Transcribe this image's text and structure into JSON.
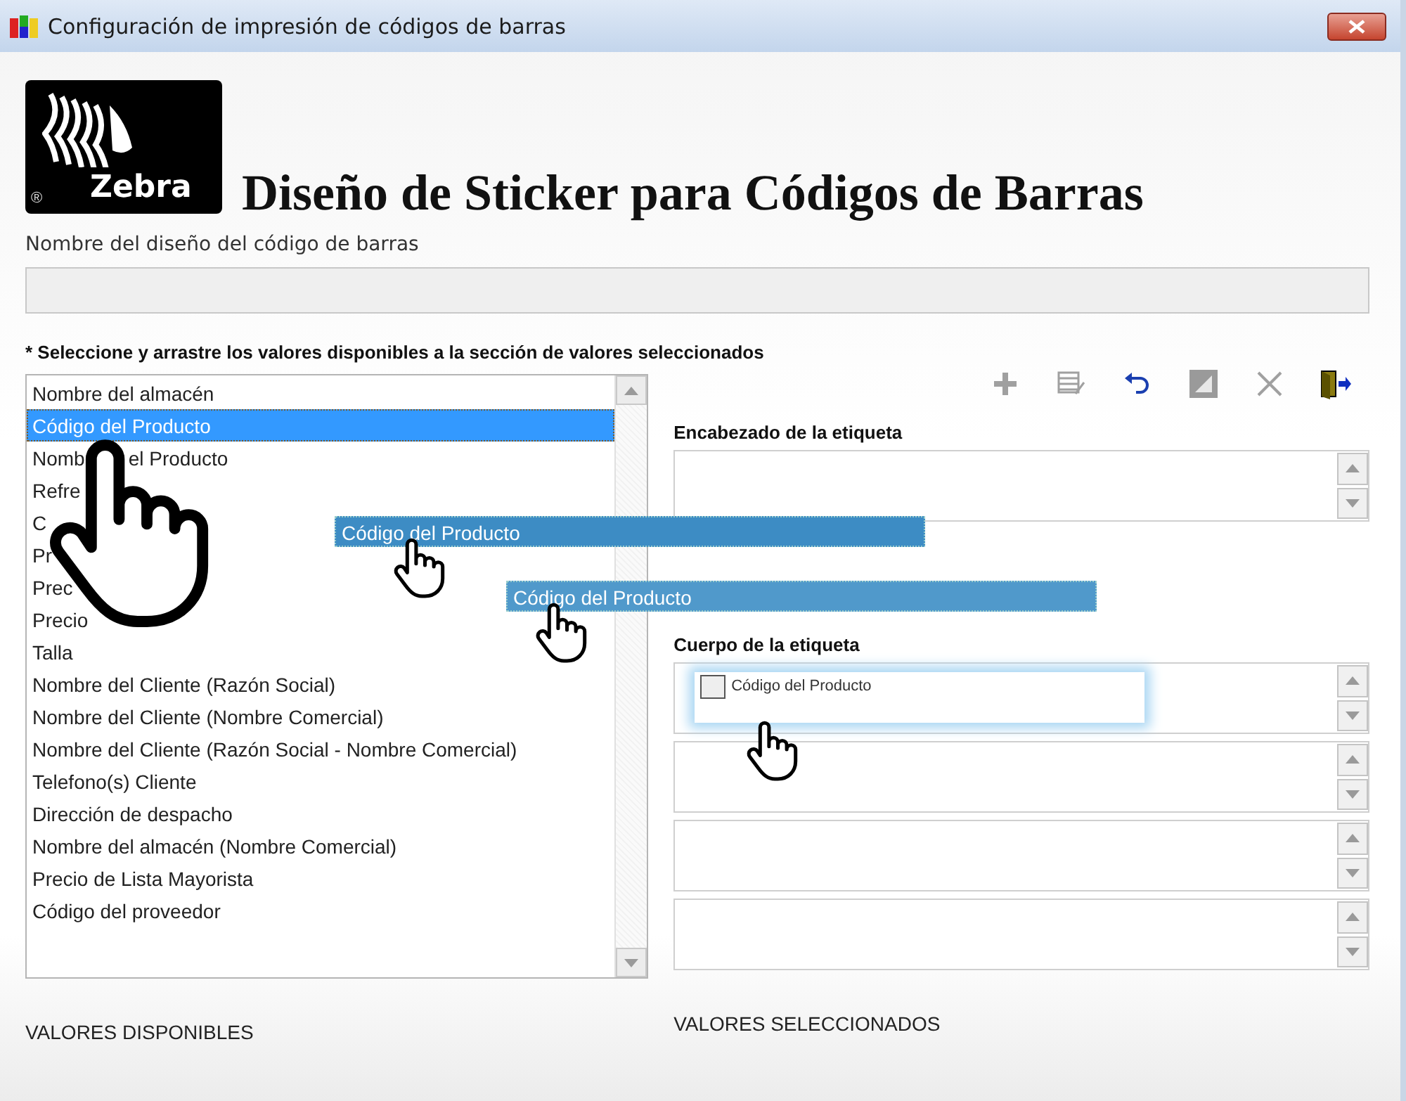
{
  "window": {
    "title": "Configuración de impresión de códigos de barras"
  },
  "logo": {
    "text": "Zebra",
    "mark": "®"
  },
  "heading": "Diseño de Sticker para Códigos de Barras",
  "design_name": {
    "label": "Nombre del diseño del código de barras"
  },
  "instruction": "* Seleccione y arrastre los valores disponibles a la sección de valores seleccionados",
  "toolbar": [
    {
      "kind": "add",
      "disabled": true
    },
    {
      "kind": "edit",
      "disabled": true
    },
    {
      "kind": "undo",
      "disabled": false
    },
    {
      "kind": "clear",
      "disabled": true
    },
    {
      "kind": "delete",
      "disabled": true
    },
    {
      "kind": "exit",
      "disabled": false
    }
  ],
  "available": {
    "items": [
      {
        "label": "Nombre del almacén",
        "selected": false
      },
      {
        "label": "Código del Producto",
        "selected": true
      },
      {
        "label": "Nomb",
        "tail": "el Producto",
        "selected": false
      },
      {
        "label": "Refre",
        "selected": false
      },
      {
        "label": "C",
        "selected": false
      },
      {
        "label": "Pr",
        "selected": false
      },
      {
        "label": "Prec",
        "selected": false
      },
      {
        "label": "Precio",
        "selected": false
      },
      {
        "label": "Talla",
        "selected": false
      },
      {
        "label": "Nombre del Cliente (Razón Social)",
        "selected": false
      },
      {
        "label": "Nombre del Cliente (Nombre Comercial)",
        "selected": false
      },
      {
        "label": "Nombre del Cliente (Razón Social - Nombre Comercial)",
        "selected": false
      },
      {
        "label": "Telefono(s) Cliente",
        "selected": false
      },
      {
        "label": "Dirección de despacho",
        "selected": false
      },
      {
        "label": "Nombre del almacén (Nombre Comercial)",
        "selected": false
      },
      {
        "label": "Precio de Lista Mayorista",
        "selected": false
      },
      {
        "label": "Código del proveedor",
        "selected": false
      }
    ],
    "caption": "VALORES DISPONIBLES"
  },
  "drag_ghosts": [
    {
      "label": "Código del Producto",
      "kind": "strong"
    },
    {
      "label": "Código del Producto",
      "kind": "faint"
    }
  ],
  "header_section": {
    "label": "Encabezado de la etiqueta"
  },
  "body_section": {
    "label": "Cuerpo de la etiqueta",
    "boxes": [
      {
        "kind": "filled",
        "item": {
          "label": "Código del Producto",
          "checked": false
        }
      },
      {
        "kind": "empty"
      },
      {
        "kind": "empty"
      },
      {
        "kind": "empty"
      }
    ]
  },
  "selected_caption": "VALORES SELECCIONADOS"
}
